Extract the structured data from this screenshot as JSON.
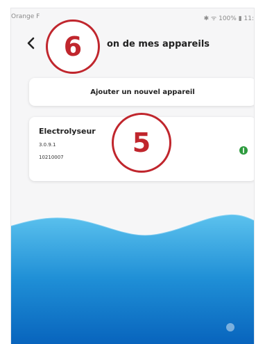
{
  "status_bar": {
    "carrier": "Orange F",
    "right": "✱ ᯤ 100% ▮ 11:"
  },
  "header": {
    "title": "on de mes appareils",
    "back_icon": "chevron-left-icon"
  },
  "add_device_label": "Ajouter un nouvel appareil",
  "devices": [
    {
      "name": "Electrolyseur",
      "version": "3.0.9.1",
      "id": "10210007",
      "status_color": "#2e9b3f"
    }
  ],
  "annotations": [
    "6",
    "5"
  ],
  "colors": {
    "accent_red": "#c0262d",
    "wave_light": "#4fb8e8",
    "wave_dark": "#0a71c6"
  }
}
